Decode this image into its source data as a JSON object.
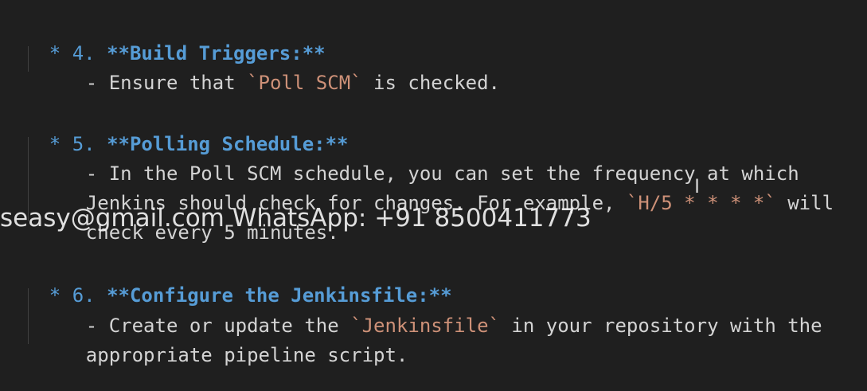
{
  "items": [
    {
      "marker": "* ",
      "number": "4. ",
      "heading": "**Build Triggers:**",
      "lines": [
        [
          {
            "t": "- Ensure that ",
            "c": "dash"
          },
          {
            "t": "`Poll SCM`",
            "c": "code"
          },
          {
            "t": " is checked.",
            "c": "dash"
          }
        ]
      ]
    },
    {
      "marker": "* ",
      "number": "5. ",
      "heading": "**Polling Schedule:**",
      "lines": [
        [
          {
            "t": "- In the Poll SCM schedule, you can set the frequency at which",
            "c": "dash"
          }
        ],
        [
          {
            "t": "Jenkins should check for changes. For example, ",
            "c": "dash"
          },
          {
            "t": "`H/5 * * * *`",
            "c": "code"
          },
          {
            "t": " will",
            "c": "dash"
          }
        ],
        [
          {
            "t": "check every 5 minutes.",
            "c": "dash"
          }
        ]
      ]
    },
    {
      "marker": "* ",
      "number": "6. ",
      "heading": "**Configure the Jenkinsfile:**",
      "lines": [
        [
          {
            "t": "- Create or update the ",
            "c": "dash"
          },
          {
            "t": "`Jenkinsfile`",
            "c": "code"
          },
          {
            "t": " in your repository with the",
            "c": "dash"
          }
        ],
        [
          {
            "t": "appropriate pipeline script.",
            "c": "dash"
          }
        ]
      ]
    }
  ],
  "watermark": "seasy@gmail.com WhatsApp: +91 8500411773",
  "cursor_glyph": "I",
  "colors": {
    "background": "#1f1f1f",
    "heading": "#569cd6",
    "text": "#d4d4d4",
    "inline_code": "#ce9178"
  }
}
